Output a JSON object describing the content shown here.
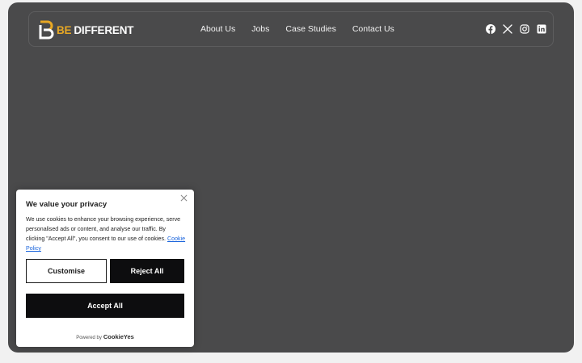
{
  "brand": {
    "logo_be": "BE",
    "logo_different": "DIFFERENT",
    "accent_color": "#e8a824"
  },
  "nav": {
    "items": [
      {
        "label": "About Us"
      },
      {
        "label": "Jobs"
      },
      {
        "label": "Case Studies"
      },
      {
        "label": "Contact Us"
      }
    ]
  },
  "socials": [
    {
      "icon": "facebook-icon"
    },
    {
      "icon": "x-twitter-icon"
    },
    {
      "icon": "instagram-icon"
    },
    {
      "icon": "linkedin-icon"
    }
  ],
  "cookie_banner": {
    "title": "We value your privacy",
    "description": "We use cookies to enhance your browsing experience, serve personalised ads or content, and analyse our traffic. By clicking \"Accept All\", you consent to our use of cookies.",
    "policy_link": "Cookie Policy",
    "customise_label": "Customise",
    "reject_label": "Reject All",
    "accept_label": "Accept All",
    "powered_by": "Powered by",
    "powered_brand": "CookieYes",
    "close_icon": "close-icon"
  },
  "colors": {
    "page_background": "#4a4a4b",
    "button_dark": "#0d0d0f",
    "link": "#1863dc"
  }
}
